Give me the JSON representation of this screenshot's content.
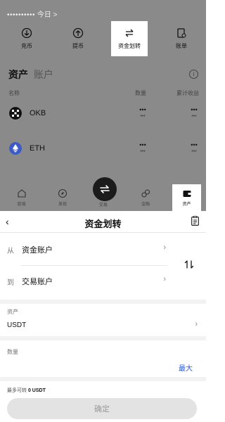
{
  "account": {
    "masked_id": "••••••••••",
    "period": "今日",
    "arrow": ">"
  },
  "actions": [
    {
      "label": "充币",
      "icon": "deposit-icon"
    },
    {
      "label": "提币",
      "icon": "withdraw-icon"
    },
    {
      "label": "资金划转",
      "icon": "transfer-icon"
    },
    {
      "label": "账单",
      "icon": "bill-icon"
    }
  ],
  "asset_tabs": {
    "active": "资产",
    "inactive": "账户"
  },
  "asset_table": {
    "headers": {
      "name": "名称",
      "qty": "数量",
      "pnl": "累计收益"
    },
    "rows": [
      {
        "coin": "OKB",
        "qty_mask": "•••",
        "qty_sub": "•••",
        "pnl_mask": "•••",
        "pnl_sub": "•••"
      },
      {
        "coin": "ETH",
        "qty_mask": "•••",
        "qty_sub": "•••",
        "pnl_mask": "•••",
        "pnl_sub": "•••"
      }
    ]
  },
  "bottom_nav": [
    {
      "label": "欧易",
      "icon": "home-icon"
    },
    {
      "label": "发现",
      "icon": "discover-icon"
    },
    {
      "label": "交易",
      "icon": "trade-icon"
    },
    {
      "label": "金融",
      "icon": "finance-icon"
    },
    {
      "label": "资产",
      "icon": "wallet-icon",
      "active": true
    }
  ],
  "transfer": {
    "back": "‹",
    "title": "资金划转",
    "from_prefix": "从",
    "from_value": "资金账户",
    "to_prefix": "到",
    "to_value": "交易账户",
    "chevron": "›",
    "asset_label": "资产",
    "asset_value": "USDT",
    "amount_label": "数量",
    "amount_placeholder": "",
    "max_label": "最大",
    "available_prefix": "最多可转",
    "available_value": "0 USDT",
    "confirm_label": "确定"
  },
  "colors": {
    "overlay": "#8a8a8a",
    "link": "#2a5bd7",
    "disabled_btn": "#e3e3e3"
  }
}
